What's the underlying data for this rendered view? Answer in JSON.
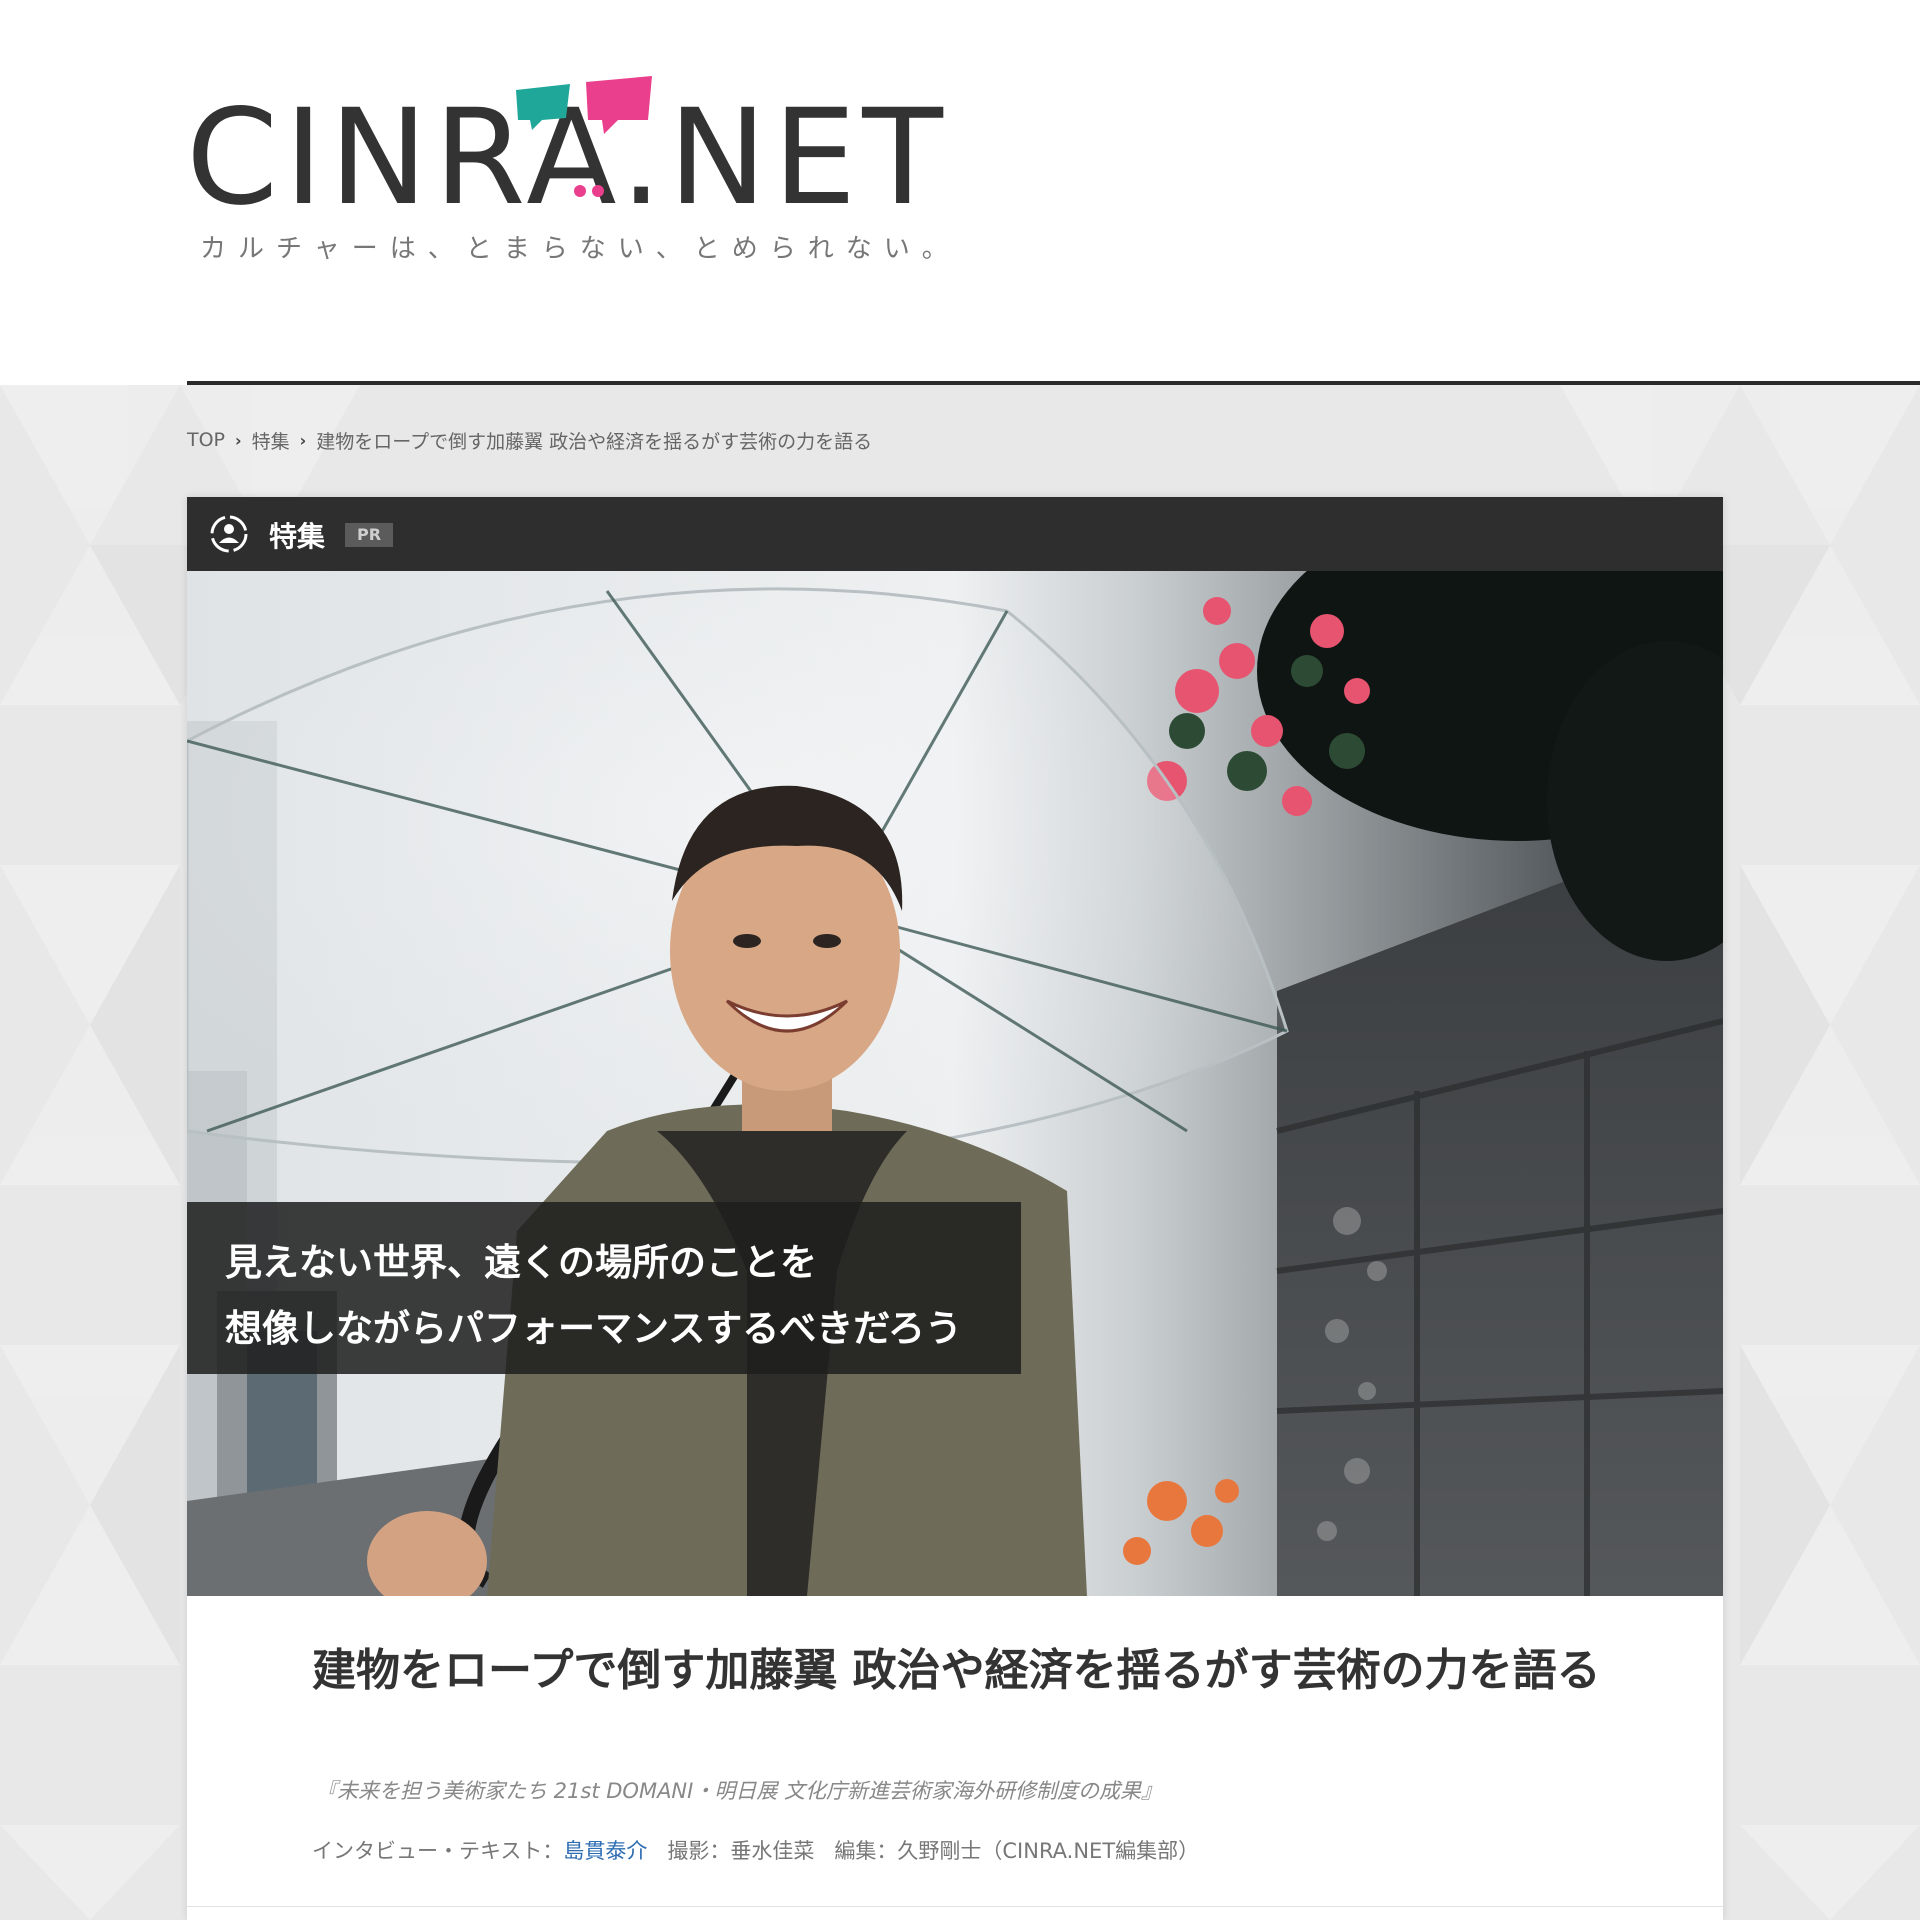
{
  "header": {
    "logo_text": "CINRA.NET",
    "tagline": "カルチャーは、とまらない、とめられない。",
    "colors": {
      "logo_text": "#333333",
      "bubble_teal": "#1fa89a",
      "bubble_pink": "#ea3f8c"
    }
  },
  "breadcrumb": {
    "items": [
      "TOP",
      "特集",
      "建物をロープで倒す加藤翼 政治や経済を揺るがす芸術の力を語る"
    ]
  },
  "card": {
    "section_label": "特集",
    "pr_badge": "PR",
    "hero_icon": "person-circle-icon",
    "quote_lines": [
      "見えない世界、遠くの場所のことを",
      "想像しながらパフォーマンスするべきだろう"
    ],
    "title": "建物をロープで倒す加藤翼 政治や経済を揺るがす芸術の力を語る",
    "subtitle": "『未来を担う美術家たち 21st DOMANI・明日展 文化庁新進芸術家海外研修制度の成果』",
    "credits": {
      "interview_label": "インタビュー・テキスト：",
      "interview_name": "島貫泰介",
      "photo_label": "撮影：",
      "photo_name": "垂水佳菜",
      "edit_label": "編集：",
      "edit_name": "久野剛士（CINRA.NET編集部）"
    }
  }
}
